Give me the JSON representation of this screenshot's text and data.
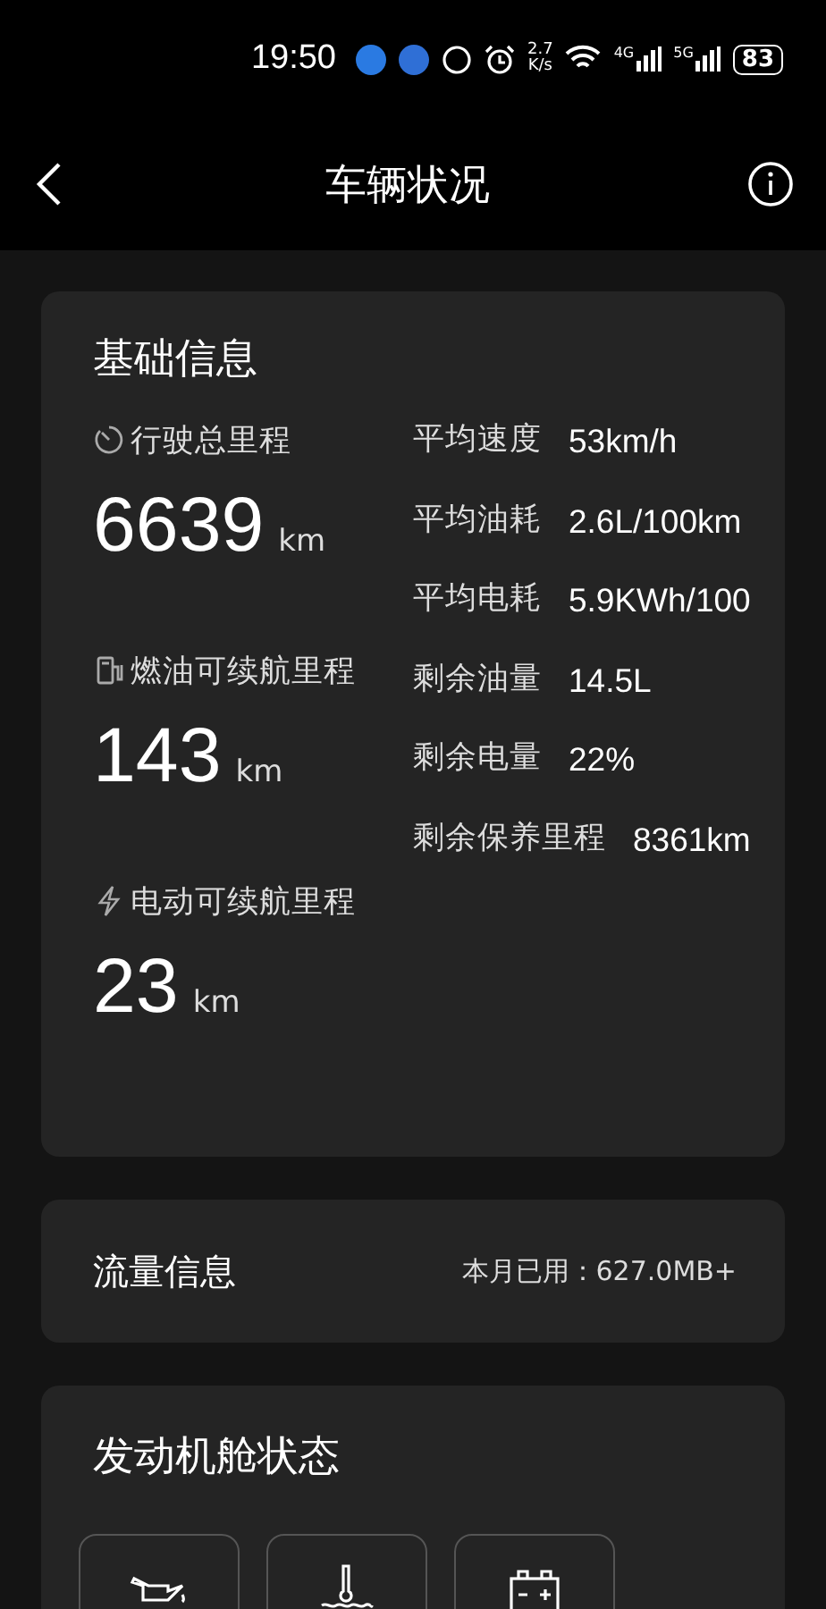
{
  "status_bar": {
    "time": "19:50",
    "net_speed": [
      "2.7",
      "K/s"
    ],
    "network_labels": [
      "4G",
      "5G"
    ],
    "battery": "83"
  },
  "header": {
    "title": "车辆状况"
  },
  "basic_info": {
    "title": "基础信息",
    "ranges": [
      {
        "kind": "odometer",
        "label": "行驶总里程",
        "value": "6639",
        "unit": "km"
      },
      {
        "kind": "fuel",
        "label": "燃油可续航里程",
        "value": "143",
        "unit": "km"
      },
      {
        "kind": "electric",
        "label": "电动可续航里程",
        "value": "23",
        "unit": "km"
      }
    ],
    "stats": [
      {
        "label": "平均速度",
        "value": "53km/h"
      },
      {
        "label": "平均油耗",
        "value": "2.6L/100km"
      },
      {
        "label": "平均电耗",
        "value": "5.9KWh/100"
      },
      {
        "label": "剩余油量",
        "value": "14.5L"
      },
      {
        "label": "剩余电量",
        "value": "22%"
      },
      {
        "label": "剩余保养里程",
        "value": "8361km"
      }
    ]
  },
  "data_usage": {
    "title": "流量信息",
    "label": "本月已用：",
    "value": "627.0MB+"
  },
  "engine_bay": {
    "title": "发动机舱状态",
    "items": [
      {
        "kind": "oil"
      },
      {
        "kind": "coolant"
      },
      {
        "kind": "battery"
      }
    ]
  }
}
